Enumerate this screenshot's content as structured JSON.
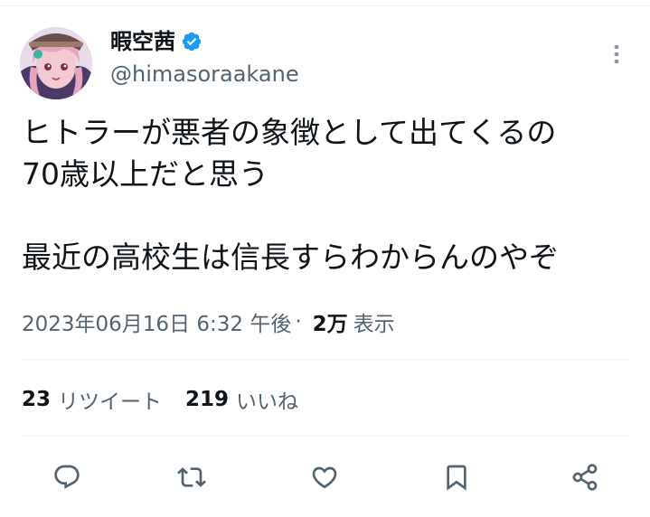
{
  "tweet": {
    "author": {
      "display_name": "暇空茜",
      "handle": "@himasoraakane",
      "verified": true,
      "avatar_icon": "avatar-anime-girl"
    },
    "text_lines": [
      "ヒトラーが悪者の象徴として出てくるの",
      "70歳以上だと思う",
      "",
      "最近の高校生は信長すらわからんのやぞ"
    ],
    "timestamp": "2023年06月16日 6:32 午後",
    "separator": "·",
    "views_count": "2万",
    "views_label": "表示",
    "stats": {
      "retweets_count": "23",
      "retweets_label": "リツイート",
      "likes_count": "219",
      "likes_label": "いいね"
    },
    "actions": [
      {
        "name": "reply",
        "icon": "reply-icon"
      },
      {
        "name": "retweet",
        "icon": "retweet-icon"
      },
      {
        "name": "like",
        "icon": "like-icon"
      },
      {
        "name": "bookmark",
        "icon": "bookmark-icon"
      },
      {
        "name": "share",
        "icon": "share-icon"
      }
    ],
    "colors": {
      "text_primary": "#0f1419",
      "text_secondary": "#536471",
      "verified_blue": "#1d9bf0",
      "divider": "#eff3f4"
    }
  }
}
